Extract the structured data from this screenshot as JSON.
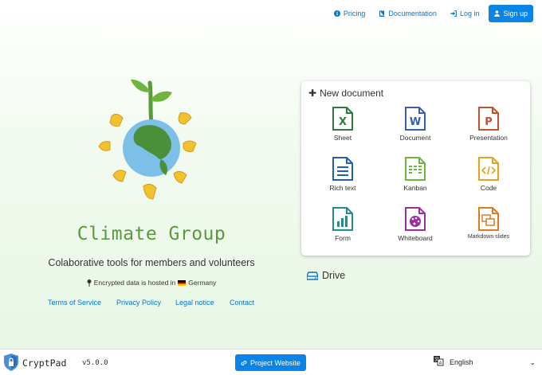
{
  "nav": {
    "pricing": "Pricing",
    "documentation": "Documentation",
    "login": "Log in",
    "signup": "Sign up"
  },
  "hero": {
    "title": "Climate Group",
    "subtitle": "Colaborative tools for members and volunteers",
    "hosted_prefix": "Encrypted data is hosted in",
    "hosted_country": "Germany"
  },
  "links": {
    "terms": "Terms of Service",
    "privacy": "Privacy Policy",
    "legal": "Legal notice",
    "contact": "Contact"
  },
  "new_document": {
    "heading": "New document",
    "apps": [
      {
        "label": "Sheet",
        "icon": "sheet-icon",
        "color": "#2f7a3f"
      },
      {
        "label": "Document",
        "icon": "document-icon",
        "color": "#3a5fa8"
      },
      {
        "label": "Presentation",
        "icon": "presentation-icon",
        "color": "#c0532a"
      },
      {
        "label": "Rich text",
        "icon": "richtext-icon",
        "color": "#1f5fbf"
      },
      {
        "label": "Kanban",
        "icon": "kanban-icon",
        "color": "#6fb43f"
      },
      {
        "label": "Code",
        "icon": "code-icon",
        "color": "#e3a31a"
      },
      {
        "label": "Form",
        "icon": "form-icon",
        "color": "#1e8f8a"
      },
      {
        "label": "Whiteboard",
        "icon": "whiteboard-icon",
        "color": "#9a2da0"
      },
      {
        "label": "Markdown slides",
        "icon": "slides-icon",
        "color": "#e07b24"
      }
    ]
  },
  "drive": {
    "label": "Drive"
  },
  "footer": {
    "brand": "CryptPad",
    "version": "v5.0.0",
    "project_website": "Project Website",
    "language": "English"
  },
  "colors": {
    "accent": "#0b84e8",
    "link": "#0b74c9",
    "brand_green": "#5b9a3c"
  }
}
